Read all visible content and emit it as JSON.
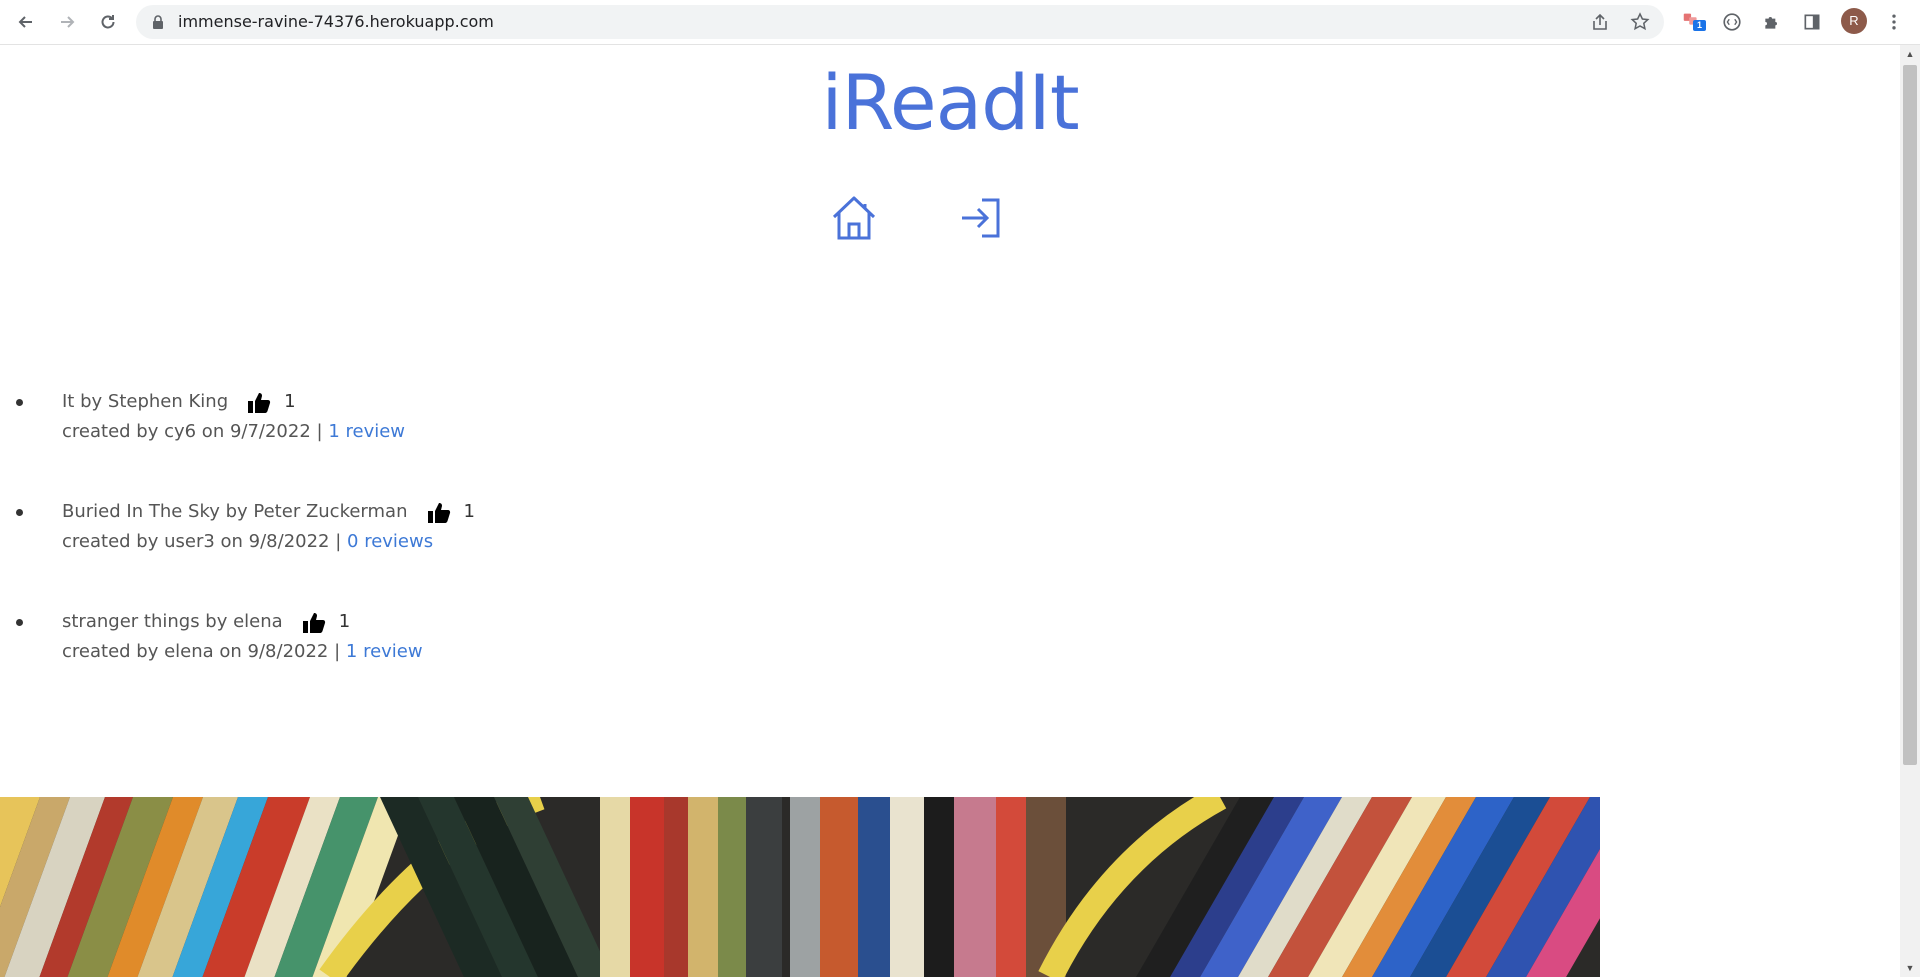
{
  "browser": {
    "url": "immense-ravine-74376.herokuapp.com",
    "extension_badge": "1",
    "profile_initial": "R",
    "icons": [
      "back-arrow-icon",
      "forward-arrow-icon",
      "reload-icon",
      "lock-icon",
      "share-icon",
      "star-icon",
      "extension-icon",
      "devtools-icon",
      "puzzle-icon",
      "side-panel-icon",
      "kebab-menu-icon"
    ]
  },
  "site": {
    "title": "iReadIt",
    "nav": [
      "home-icon",
      "login-icon"
    ]
  },
  "books": [
    {
      "title": "It by Stephen King",
      "likes": "1",
      "meta": "created by cy6 on 9/7/2022 | ",
      "reviews": "1 review"
    },
    {
      "title": "Buried In The Sky by Peter Zuckerman",
      "likes": "1",
      "meta": "created by user3 on 9/8/2022 | ",
      "reviews": "0 reviews"
    },
    {
      "title": "stranger things by elena",
      "likes": "1",
      "meta": "created by elena on 9/8/2022 | ",
      "reviews": "1 review"
    }
  ],
  "colors": {
    "accent": "#4a72d9",
    "link": "#3d79d6",
    "text": "#555555"
  }
}
